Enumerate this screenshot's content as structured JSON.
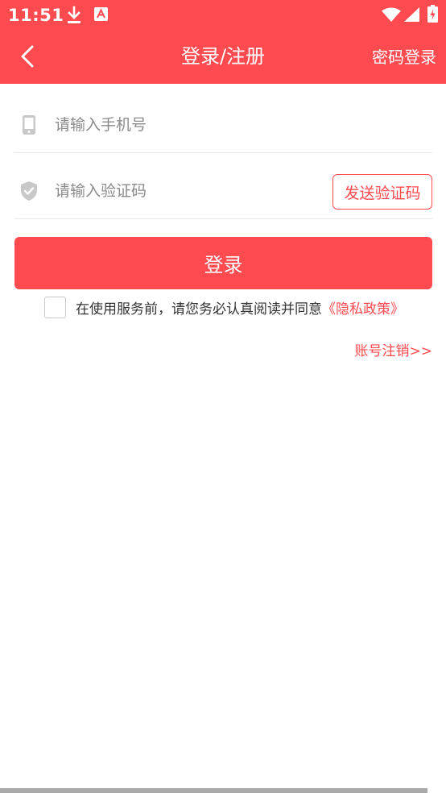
{
  "status_bar": {
    "time": "11:51",
    "icons": [
      "download-icon",
      "app-notification-icon",
      "wifi-icon",
      "signal-icon",
      "battery-icon"
    ]
  },
  "header": {
    "title": "登录/注册",
    "right_action": "密码登录",
    "back_icon": "chevron-left-icon"
  },
  "form": {
    "phone_placeholder": "请输入手机号",
    "phone_value": "",
    "phone_icon": "phone-icon",
    "code_placeholder": "请输入验证码",
    "code_value": "",
    "code_icon": "shield-icon",
    "send_code_label": "发送验证码"
  },
  "login_button": "登录",
  "agreement": {
    "checked": false,
    "text": "在使用服务前，请您务必认真阅读并同意",
    "link": "《隐私政策》"
  },
  "cancel_account_link": "账号注销>>",
  "colors": {
    "primary": "#ff4a50",
    "placeholder": "#8a8a8a",
    "icon": "#c8c8c8",
    "divider": "#e8e8e8"
  }
}
